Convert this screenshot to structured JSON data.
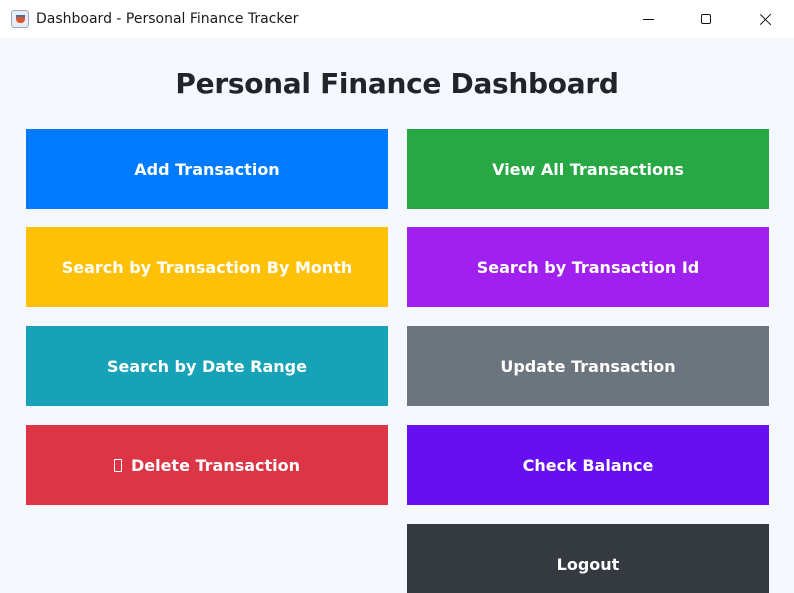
{
  "window": {
    "title": "Dashboard - Personal Finance Tracker",
    "icon": "java-cup-icon"
  },
  "heading": "Personal Finance Dashboard",
  "buttons": {
    "add_transaction": {
      "label": "Add Transaction",
      "color": "#007bff"
    },
    "view_all": {
      "label": "View All Transactions",
      "color": "#28a745"
    },
    "search_month": {
      "label": "Search by Transaction By Month",
      "color": "#ffc107"
    },
    "search_id": {
      "label": "Search by Transaction Id",
      "color": "#a020f0"
    },
    "search_date_range": {
      "label": "Search by Date Range",
      "color": "#17a2b8"
    },
    "update_transaction": {
      "label": "Update Transaction",
      "color": "#6c757d"
    },
    "delete_transaction": {
      "label": "Delete Transaction",
      "color": "#dc3545",
      "icon": "missing-glyph-icon"
    },
    "check_balance": {
      "label": "Check Balance",
      "color": "#6610f2"
    },
    "logout": {
      "label": "Logout",
      "color": "#343a40"
    }
  }
}
